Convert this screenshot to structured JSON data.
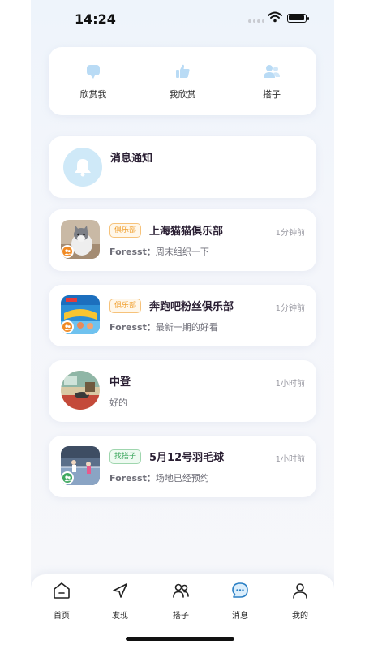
{
  "status_bar": {
    "time": "14:24"
  },
  "top_actions": [
    {
      "label": "欣赏我",
      "icon": "chat-bubble-icon"
    },
    {
      "label": "我欣赏",
      "icon": "thumbs-up-icon"
    },
    {
      "label": "搭子",
      "icon": "people-icon"
    }
  ],
  "notice": {
    "title": "消息通知",
    "icon": "bell-icon"
  },
  "messages": [
    {
      "tag": "俱乐部",
      "tag_color": "#f0a030",
      "name": "上海猫猫俱乐部",
      "time": "1分钟前",
      "sender": "Foresst：",
      "text": "周末组织一下",
      "badge_color": "#f08a24"
    },
    {
      "tag": "俱乐部",
      "tag_color": "#f0a030",
      "name": "奔跑吧粉丝俱乐部",
      "time": "1分钟前",
      "sender": "Foresst：",
      "text": "最新一期的好看",
      "badge_color": "#f08a24"
    },
    {
      "tag": "",
      "name": "中登",
      "time": "1小时前",
      "sender": "",
      "text": "好的"
    },
    {
      "tag": "找搭子",
      "tag_color": "#4ab26a",
      "name": "5月12号羽毛球",
      "time": "1小时前",
      "sender": "Foresst：",
      "text": "场地已经预约",
      "badge_color": "#3fa860"
    }
  ],
  "tabbar": [
    {
      "label": "首页",
      "icon": "home-icon"
    },
    {
      "label": "发现",
      "icon": "compass-icon"
    },
    {
      "label": "搭子",
      "icon": "people-icon"
    },
    {
      "label": "消息",
      "icon": "message-icon"
    },
    {
      "label": "我的",
      "icon": "profile-icon"
    }
  ]
}
